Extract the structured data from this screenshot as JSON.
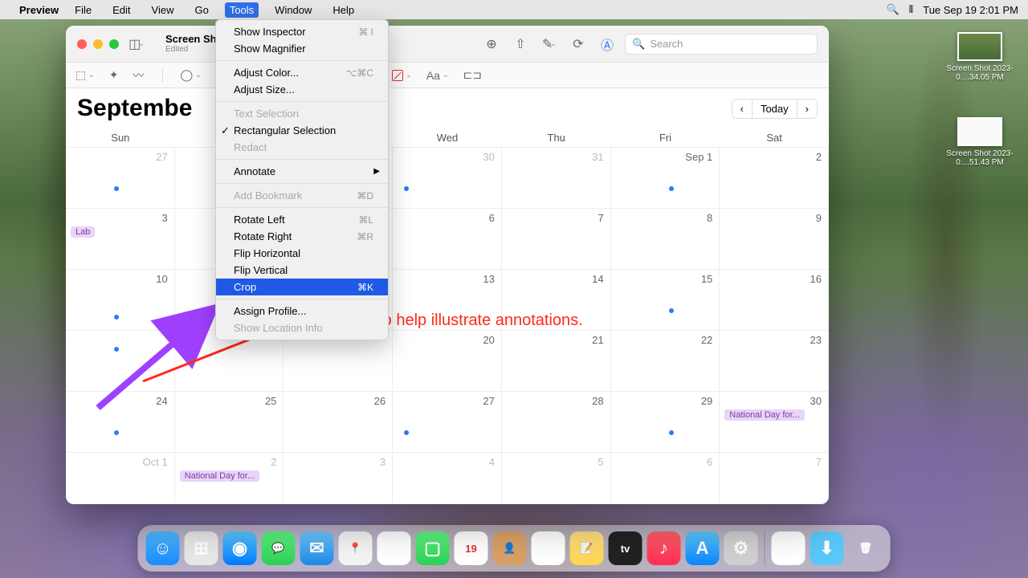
{
  "menubar": {
    "app": "Preview",
    "items": [
      "File",
      "Edit",
      "View",
      "Go",
      "Tools",
      "Window",
      "Help"
    ],
    "open_index": 4,
    "clock": "Tue Sep 19  2:01 PM"
  },
  "dropdown": {
    "items": [
      {
        "label": "Show Inspector",
        "shortcut": "⌘ I"
      },
      {
        "label": "Show Magnifier",
        "shortcut": ""
      },
      {
        "sep": true
      },
      {
        "label": "Adjust Color...",
        "shortcut": "⌥⌘C"
      },
      {
        "label": "Adjust Size...",
        "shortcut": ""
      },
      {
        "sep": true
      },
      {
        "label": "Text Selection",
        "disabled": true
      },
      {
        "label": "Rectangular Selection",
        "checked": true
      },
      {
        "label": "Redact",
        "disabled": true
      },
      {
        "sep": true
      },
      {
        "label": "Annotate",
        "submenu": true
      },
      {
        "sep": true
      },
      {
        "label": "Add Bookmark",
        "shortcut": "⌘D",
        "disabled": true
      },
      {
        "sep": true
      },
      {
        "label": "Rotate Left",
        "shortcut": "⌘L"
      },
      {
        "label": "Rotate Right",
        "shortcut": "⌘R"
      },
      {
        "label": "Flip Horizontal"
      },
      {
        "label": "Flip Vertical"
      },
      {
        "label": "Crop",
        "shortcut": "⌘K",
        "highlight": true
      },
      {
        "sep": true
      },
      {
        "label": "Assign Profile..."
      },
      {
        "label": "Show Location Info",
        "disabled": true
      }
    ]
  },
  "window": {
    "title": "Screen Sh",
    "subtitle": "Edited",
    "search_placeholder": "Search"
  },
  "toolbar2": {
    "text_style": "Aa"
  },
  "calendar": {
    "month": "Septembe",
    "today_label": "Today",
    "dow": [
      "Sun",
      "",
      "",
      "Wed",
      "Thu",
      "Fri",
      "Sat"
    ],
    "rows": [
      [
        {
          "n": "27",
          "other": true,
          "dot": [
            60,
            48
          ]
        },
        {
          "n": ""
        },
        {
          "n": ""
        },
        {
          "n": "30",
          "other": true,
          "dot": [
            14,
            48
          ]
        },
        {
          "n": "31",
          "other": true
        },
        {
          "n": "Sep 1",
          "dot": [
            72,
            48
          ]
        },
        {
          "n": "2"
        }
      ],
      [
        {
          "n": "3",
          "ev": "Lab"
        },
        {
          "n": ""
        },
        {
          "n": ""
        },
        {
          "n": "6"
        },
        {
          "n": "7"
        },
        {
          "n": "8"
        },
        {
          "n": "9"
        }
      ],
      [
        {
          "n": "10",
          "dot": [
            60,
            56
          ]
        },
        {
          "n": ""
        },
        {
          "n": ""
        },
        {
          "n": "13"
        },
        {
          "n": "14"
        },
        {
          "n": "15",
          "dot": [
            72,
            48
          ]
        },
        {
          "n": "16"
        }
      ],
      [
        {
          "n": "",
          "dot": [
            60,
            20
          ]
        },
        {
          "n": ""
        },
        {
          "n": ""
        },
        {
          "n": "20"
        },
        {
          "n": "21"
        },
        {
          "n": "22"
        },
        {
          "n": "23"
        }
      ],
      [
        {
          "n": "24",
          "dot": [
            60,
            48
          ]
        },
        {
          "n": "25"
        },
        {
          "n": "26"
        },
        {
          "n": "27",
          "dot": [
            14,
            48
          ]
        },
        {
          "n": "28"
        },
        {
          "n": "29",
          "dot": [
            72,
            48
          ]
        },
        {
          "n": "30",
          "ev": "National Day for..."
        }
      ],
      [
        {
          "n": "Oct 1",
          "other": true
        },
        {
          "n": "2",
          "other": true,
          "ev": "National Day for..."
        },
        {
          "n": "3",
          "other": true
        },
        {
          "n": "4",
          "other": true
        },
        {
          "n": "5",
          "other": true
        },
        {
          "n": "6",
          "other": true
        },
        {
          "n": "7",
          "other": true
        }
      ]
    ],
    "annotation_text": "t to help illustrate annotations."
  },
  "desktop_files": [
    {
      "name": "Screen Shot 2023-0....34.05 PM"
    },
    {
      "name": "Screen Shot 2023-0....51.43 PM"
    }
  ],
  "dock": {
    "apps": [
      {
        "name": "finder",
        "bg": "linear-gradient(#4db8ff,#1a8cff)",
        "glyph": "☺"
      },
      {
        "name": "launchpad",
        "bg": "#e8e8e8",
        "glyph": "⊞"
      },
      {
        "name": "safari",
        "bg": "linear-gradient(#5ac8fa,#007aff)",
        "glyph": "◉"
      },
      {
        "name": "messages",
        "bg": "linear-gradient(#5ff281,#2bd157)",
        "glyph": "💬"
      },
      {
        "name": "mail",
        "bg": "linear-gradient(#6ec6ff,#1e88e5)",
        "glyph": "✉"
      },
      {
        "name": "maps",
        "bg": "#f4f4f4",
        "glyph": "📍"
      },
      {
        "name": "photos",
        "bg": "#fff",
        "glyph": "❀"
      },
      {
        "name": "facetime",
        "bg": "linear-gradient(#5ff281,#2bd157)",
        "glyph": "▢"
      },
      {
        "name": "calendar",
        "bg": "#fff",
        "glyph": "19"
      },
      {
        "name": "contacts",
        "bg": "#d9a066",
        "glyph": "👤"
      },
      {
        "name": "reminders",
        "bg": "#fff",
        "glyph": "☰"
      },
      {
        "name": "notes",
        "bg": "linear-gradient(#ffe082,#ffd54f)",
        "glyph": "📝"
      },
      {
        "name": "tv",
        "bg": "#222",
        "glyph": "tv"
      },
      {
        "name": "music",
        "bg": "linear-gradient(#ff5e6c,#ff2d55)",
        "glyph": "♪"
      },
      {
        "name": "appstore",
        "bg": "linear-gradient(#5ac8fa,#0a84ff)",
        "glyph": "A"
      },
      {
        "name": "settings",
        "bg": "#d0d0d0",
        "glyph": "⚙"
      }
    ],
    "extras": [
      {
        "name": "preview",
        "bg": "#fff",
        "glyph": "🖼"
      },
      {
        "name": "downloads",
        "bg": "#5ac8fa",
        "glyph": "⬇"
      },
      {
        "name": "trash",
        "bg": "transparent",
        "glyph": "🗑"
      }
    ]
  }
}
